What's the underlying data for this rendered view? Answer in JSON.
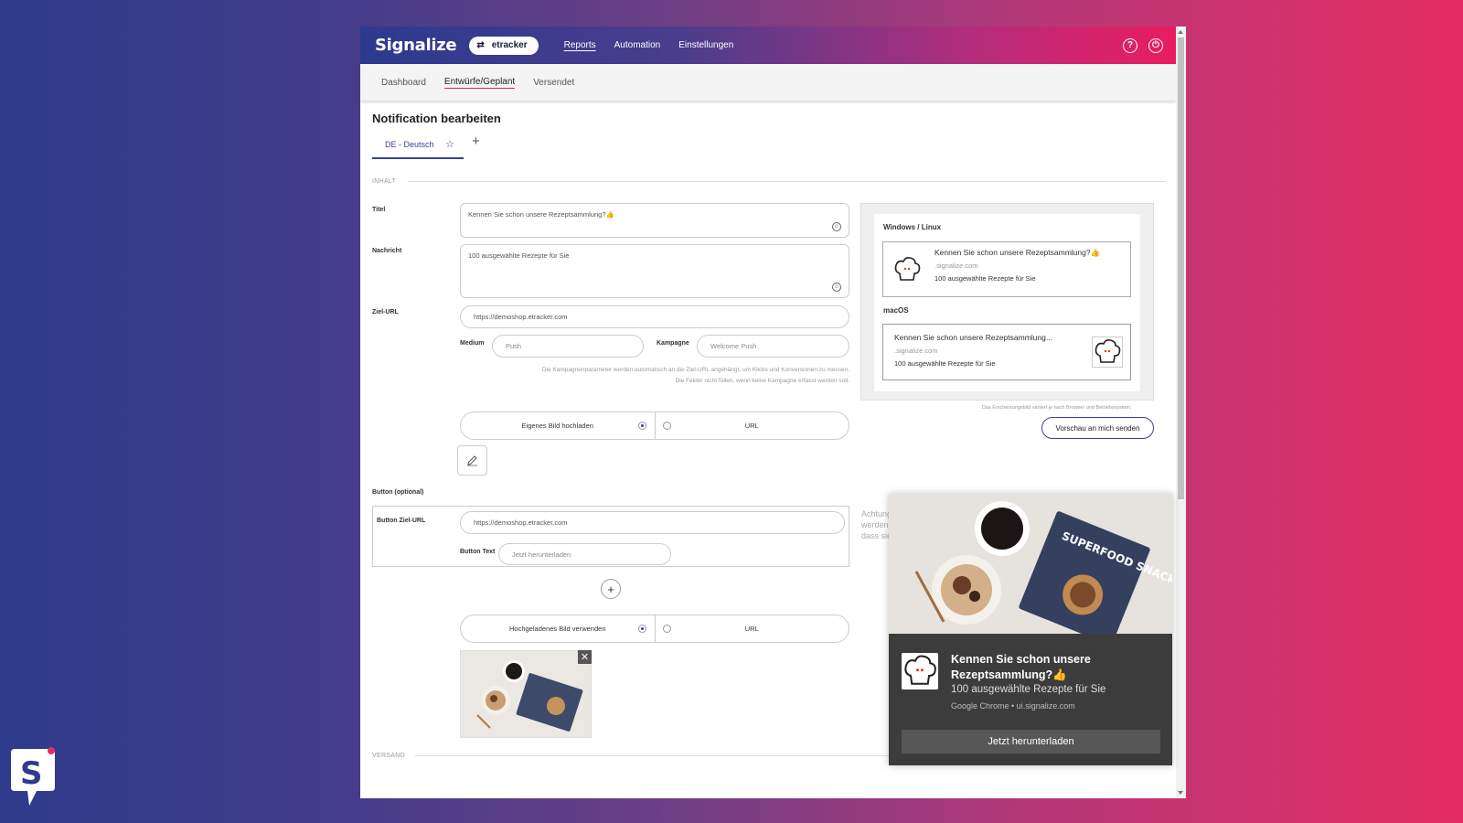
{
  "app": {
    "brand": "Signalize",
    "tenant": "etracker",
    "nav": [
      "Reports",
      "Automation",
      "Einstellungen"
    ],
    "active_nav": "Reports"
  },
  "subnav": {
    "items": [
      "Dashboard",
      "Entwürfe/Geplant",
      "Versendet"
    ],
    "active": "Entwürfe/Geplant"
  },
  "page": {
    "title": "Notification bearbeiten",
    "language_tab": "DE - Deutsch",
    "add_language": "+"
  },
  "content": {
    "section_label": "INHALT",
    "title_label": "Titel",
    "title_value": "Kennen Sie schon unsere Rezeptsammlung?👍",
    "message_label": "Nachricht",
    "message_value": "100 ausgewählte Rezepte für Sie",
    "target_label": "Ziel-URL",
    "target_value": "https://demoshop.etracker.com",
    "medium_label": "Medium",
    "medium_placeholder": "Push",
    "campaign_label": "Kampagne",
    "campaign_placeholder": "Welcome Push",
    "help_line1": "Die Kampagnenparameter werden automatisch an die Ziel-URL angehängt, um Klicks und Konversionen zu messen.",
    "help_line2": "Die Felder nicht füllen, wenn keine Kampagne erfasst werden soll.",
    "image_option_upload": "Eigenes Bild hochladen",
    "image_option_url": "URL"
  },
  "button_section": {
    "label": "Button (optional)",
    "target_label": "Button Ziel-URL",
    "target_value": "https://demoshop.etracker.com",
    "text_label": "Button Text",
    "text_placeholder": "Jetzt herunterladen",
    "add": "+",
    "image_option_uploaded": "Hochgeladenes Bild verwenden",
    "image_option_url": "URL"
  },
  "versand": {
    "section_label": "VERSAND"
  },
  "preview": {
    "windows_heading": "Windows / Linux",
    "windows_title": "Kennen Sie schon unsere Rezeptsammlung?👍",
    "windows_domain": ".signalize.com",
    "windows_message": "100 ausgewählte Rezepte für Sie",
    "mac_heading": "macOS",
    "mac_title": "Kennen Sie schon unsere Rezeptsammlung...",
    "mac_domain": ".signalize.com",
    "mac_message": "100 ausgewählte Rezepte für Sie",
    "note": "Das Erscheinungsbild variiert je nach Browser und Betriebssystem.",
    "send_button": "Vorschau an mich senden"
  },
  "warning_text": [
    "Achtung",
    "werden",
    "dass sie"
  ],
  "chrome_notification": {
    "title": "Kennen Sie schon unsere Rezeptsammlung?👍",
    "message": "100 ausgewählte Rezepte für Sie",
    "source": "Google Chrome • ui.signalize.com",
    "button": "Jetzt herunterladen",
    "book_text": "SUPERFOOD SNACKS"
  },
  "icons": {
    "swap": "swap-icon",
    "help": "help-icon",
    "power": "power-icon",
    "star": "star-icon",
    "emoji": "emoji-icon",
    "edit": "pencil-icon",
    "close": "close-icon"
  },
  "colors": {
    "accent": "#3b3f9a",
    "active_underline": "#e0245e",
    "header_start": "#2c3a8e",
    "header_end": "#ea1c5f"
  }
}
